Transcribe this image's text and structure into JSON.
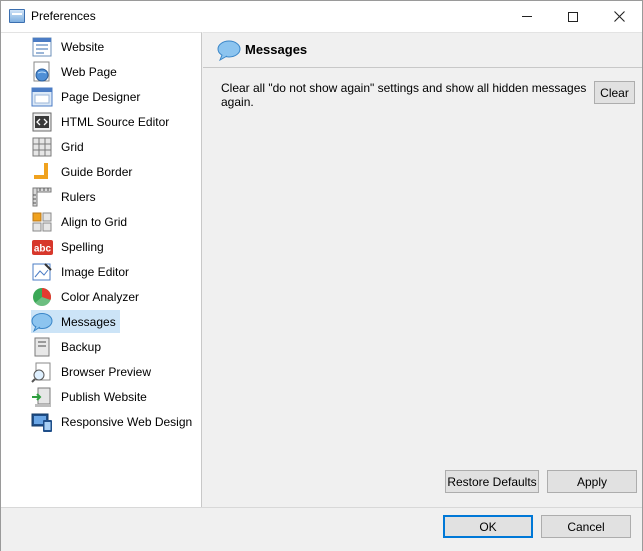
{
  "window": {
    "title": "Preferences",
    "controls": {
      "minimize": "minimize",
      "maximize": "maximize",
      "close": "close"
    }
  },
  "sidebar": {
    "items": [
      {
        "label": "Website",
        "icon": "website-icon"
      },
      {
        "label": "Web Page",
        "icon": "web-page-icon"
      },
      {
        "label": "Page Designer",
        "icon": "page-designer-icon"
      },
      {
        "label": "HTML Source Editor",
        "icon": "html-source-icon"
      },
      {
        "label": "Grid",
        "icon": "grid-icon"
      },
      {
        "label": "Guide Border",
        "icon": "guide-border-icon"
      },
      {
        "label": "Rulers",
        "icon": "rulers-icon"
      },
      {
        "label": "Align to Grid",
        "icon": "align-grid-icon"
      },
      {
        "label": "Spelling",
        "icon": "spelling-icon"
      },
      {
        "label": "Image Editor",
        "icon": "image-editor-icon"
      },
      {
        "label": "Color Analyzer",
        "icon": "color-analyzer-icon"
      },
      {
        "label": "Messages",
        "icon": "messages-icon",
        "selected": true
      },
      {
        "label": "Backup",
        "icon": "backup-icon"
      },
      {
        "label": "Browser Preview",
        "icon": "browser-preview-icon"
      },
      {
        "label": "Publish Website",
        "icon": "publish-icon"
      },
      {
        "label": "Responsive Web Design",
        "icon": "responsive-icon"
      }
    ]
  },
  "panel": {
    "title": "Messages",
    "description": "Clear all \"do not show again\" settings and show all hidden messages again.",
    "clear_label": "Clear",
    "restore_label": "Restore Defaults",
    "apply_label": "Apply"
  },
  "footer": {
    "ok_label": "OK",
    "cancel_label": "Cancel"
  },
  "colors": {
    "selection": "#cce4f7",
    "default_button_border": "#0078d7"
  }
}
